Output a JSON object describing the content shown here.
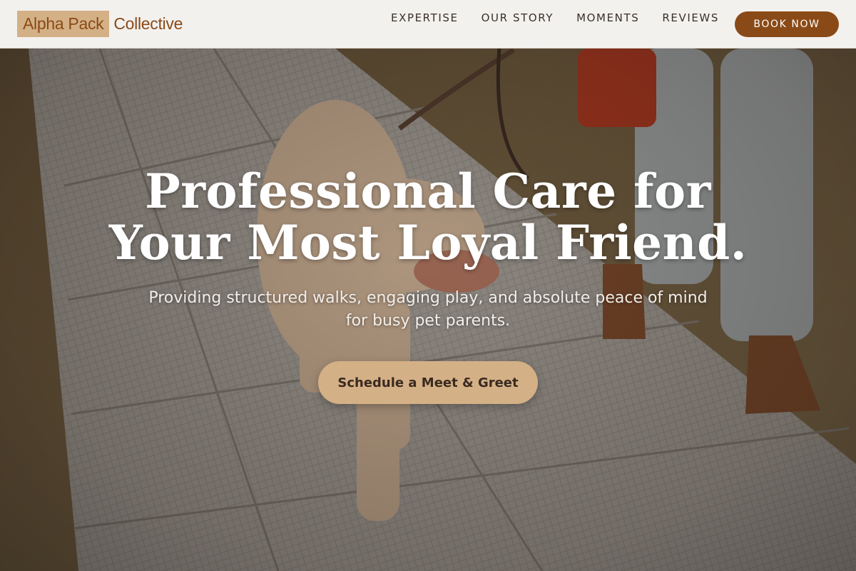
{
  "brand": {
    "logo_highlight": "Alpha Pack",
    "logo_rest": "Collective",
    "colors": {
      "accent_brown": "#8a4a17",
      "accent_tan": "#d4b086"
    }
  },
  "nav": {
    "links": [
      {
        "label": "EXPERTISE"
      },
      {
        "label": "OUR STORY"
      },
      {
        "label": "MOMENTS"
      },
      {
        "label": "REVIEWS"
      }
    ],
    "cta_label": "BOOK NOW"
  },
  "hero": {
    "headline_line1": "Professional Care for",
    "headline_line2": "Your Most Loyal Friend.",
    "subhead_line1": "Providing structured walks, engaging play, and absolute peace of mind",
    "subhead_line2": "for busy pet parents.",
    "cta_label": "Schedule a Meet & Greet"
  }
}
